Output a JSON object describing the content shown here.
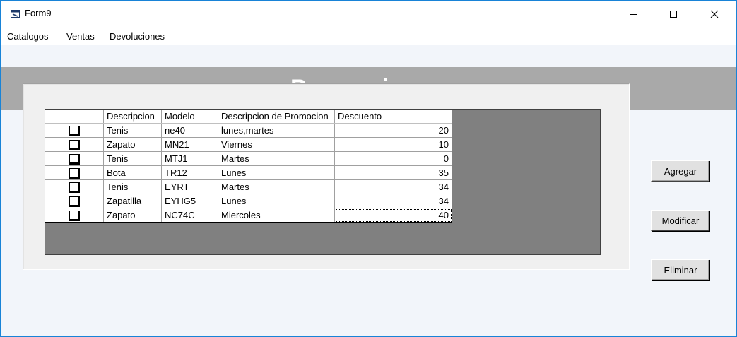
{
  "window": {
    "title": "Form9"
  },
  "menu": [
    "Catalogos",
    "Ventas",
    "Devoluciones"
  ],
  "banner": {
    "title": "Promociones"
  },
  "grid": {
    "columns": [
      "",
      "Descripcion",
      "Modelo",
      "Descripcion de Promocion",
      "Descuento"
    ],
    "rows": [
      [
        "Tenis",
        "ne40",
        "lunes,martes",
        "20"
      ],
      [
        "Zapato",
        "MN21",
        "Viernes",
        "10"
      ],
      [
        "Tenis",
        "MTJ1",
        "Martes",
        "0"
      ],
      [
        "Bota",
        "TR12",
        "Lunes",
        "35"
      ],
      [
        "Tenis",
        "EYRT",
        "Martes",
        "34"
      ],
      [
        "Zapatilla",
        "EYHG5",
        "Lunes",
        "34"
      ],
      [
        "Zapato",
        "NC74C",
        "Miercoles",
        "40"
      ]
    ]
  },
  "buttons": {
    "add": "Agregar",
    "modify": "Modificar",
    "delete": "Eliminar"
  },
  "colors": {
    "banner": "#a9a9a9",
    "grid_empty": "#808080",
    "accent_border": "#1883d7"
  },
  "icons": {
    "app": "form-window-icon",
    "minimize": "minimize-icon",
    "maximize": "maximize-icon",
    "close": "close-icon"
  }
}
